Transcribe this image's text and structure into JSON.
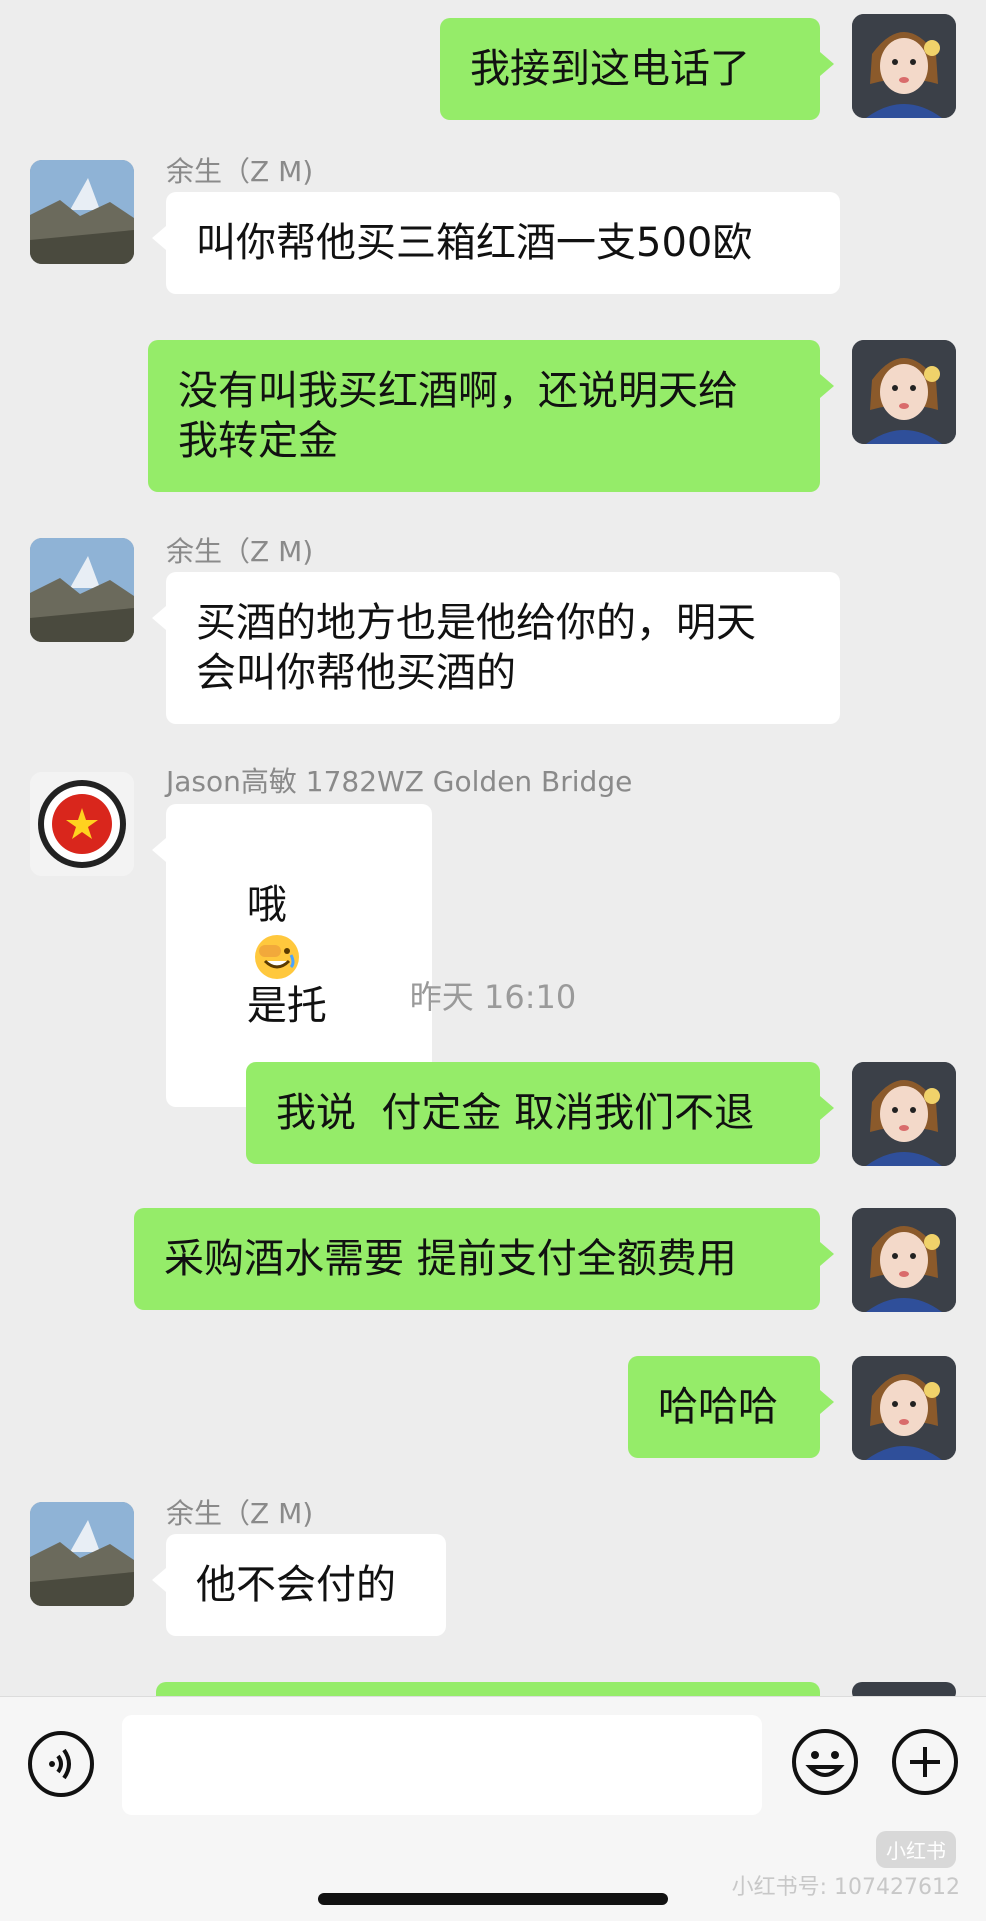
{
  "chat": {
    "messages": [
      {
        "side": "out",
        "text": "我接到这电话了"
      },
      {
        "side": "in",
        "sender": "余生（Z M)",
        "text": "叫你帮他买三箱红酒一支500欧"
      },
      {
        "side": "out",
        "text": "没有叫我买红酒啊，还说明天给\n我转定金"
      },
      {
        "side": "in",
        "sender": "余生（Z M)",
        "text": "买酒的地方也是他给你的，明天\n会叫你帮他买酒的"
      },
      {
        "side": "in",
        "sender": "Jason高敏 1782WZ Golden Bridge",
        "text_before": "哦",
        "emoji": "facepalm-laugh-emoji",
        "text_after": "是托"
      },
      {
        "type": "time",
        "text": "昨天 16:10"
      },
      {
        "side": "out",
        "text": "我说  付定金 取消我们不退"
      },
      {
        "side": "out",
        "text": "采购酒水需要 提前支付全额费用"
      },
      {
        "side": "out",
        "text": "哈哈哈"
      },
      {
        "side": "in",
        "sender": "余生（Z M)",
        "text": "他不会付的"
      }
    ]
  },
  "input_bar": {
    "voice_icon": "voice-icon",
    "emoji_icon": "smiley-icon",
    "plus_icon": "plus-icon"
  },
  "watermark": {
    "logo": "小红书",
    "text": "小红书号: 107427612"
  },
  "colors": {
    "background": "#ededed",
    "outgoing_bubble": "#95ec69",
    "incoming_bubble": "#ffffff"
  }
}
